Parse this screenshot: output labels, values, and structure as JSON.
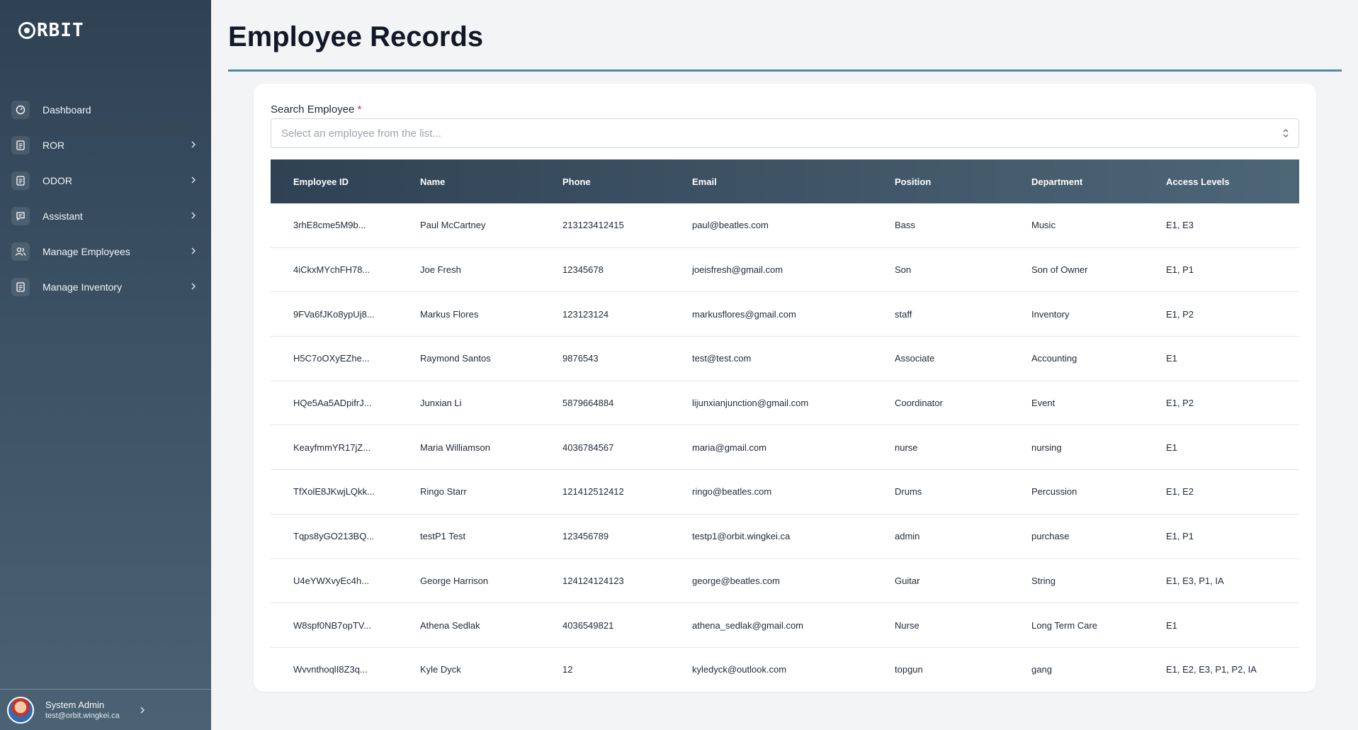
{
  "app": {
    "logo_text": "RBIT"
  },
  "sidebar": {
    "items": [
      {
        "label": "Dashboard",
        "icon": "dashboard-icon",
        "has_chevron": false
      },
      {
        "label": "ROR",
        "icon": "document-icon",
        "has_chevron": true
      },
      {
        "label": "ODOR",
        "icon": "document-icon",
        "has_chevron": true
      },
      {
        "label": "Assistant",
        "icon": "chat-icon",
        "has_chevron": true
      },
      {
        "label": "Manage Employees",
        "icon": "users-icon",
        "has_chevron": true
      },
      {
        "label": "Manage Inventory",
        "icon": "document-icon",
        "has_chevron": true
      }
    ],
    "user": {
      "name": "System Admin",
      "email": "test@orbit.wingkei.ca"
    }
  },
  "main": {
    "title": "Employee Records",
    "search": {
      "label": "Search Employee",
      "required_mark": "*",
      "placeholder": "Select an employee from the list..."
    },
    "table": {
      "columns": [
        "Employee ID",
        "Name",
        "Phone",
        "Email",
        "Position",
        "Department",
        "Access Levels"
      ],
      "rows": [
        [
          "3rhE8cme5M9b...",
          "Paul McCartney",
          "213123412415",
          "paul@beatles.com",
          "Bass",
          "Music",
          "E1, E3"
        ],
        [
          "4iCkxMYchFH78...",
          "Joe Fresh",
          "12345678",
          "joeisfresh@gmail.com",
          "Son",
          "Son of Owner",
          "E1, P1"
        ],
        [
          "9FVa6fJKo8ypUj8...",
          "Markus Flores",
          "123123124",
          "markusflores@gmail.com",
          "staff",
          "Inventory",
          "E1, P2"
        ],
        [
          "H5C7oOXyEZhe...",
          "Raymond Santos",
          "9876543",
          "test@test.com",
          "Associate",
          "Accounting",
          "E1"
        ],
        [
          "HQe5Aa5ADpifrJ...",
          "Junxian Li",
          "5879664884",
          "lijunxianjunction@gmail.com",
          "Coordinator",
          "Event",
          "E1, P2"
        ],
        [
          "KeayfmmYR17jZ...",
          "Maria Williamson",
          "4036784567",
          "maria@gmail.com",
          "nurse",
          "nursing",
          "E1"
        ],
        [
          "TfXolE8JKwjLQkk...",
          "Ringo Starr",
          "121412512412",
          "ringo@beatles.com",
          "Drums",
          "Percussion",
          "E1, E2"
        ],
        [
          "Tqps8yGO213BQ...",
          "testP1 Test",
          "123456789",
          "testp1@orbit.wingkei.ca",
          "admin",
          "purchase",
          "E1, P1"
        ],
        [
          "U4eYWXvyEc4h...",
          "George Harrison",
          "124124124123",
          "george@beatles.com",
          "Guitar",
          "String",
          "E1, E3, P1, IA"
        ],
        [
          "W8spf0NB7opTV...",
          "Athena Sedlak",
          "4036549821",
          "athena_sedlak@gmail.com",
          "Nurse",
          "Long Term Care",
          "E1"
        ],
        [
          "WvvnthoqlI8Z3q...",
          "Kyle Dyck",
          "12",
          "kyledyck@outlook.com",
          "topgun",
          "gang",
          "E1, E2, E3, P1, P2, IA"
        ]
      ]
    }
  }
}
